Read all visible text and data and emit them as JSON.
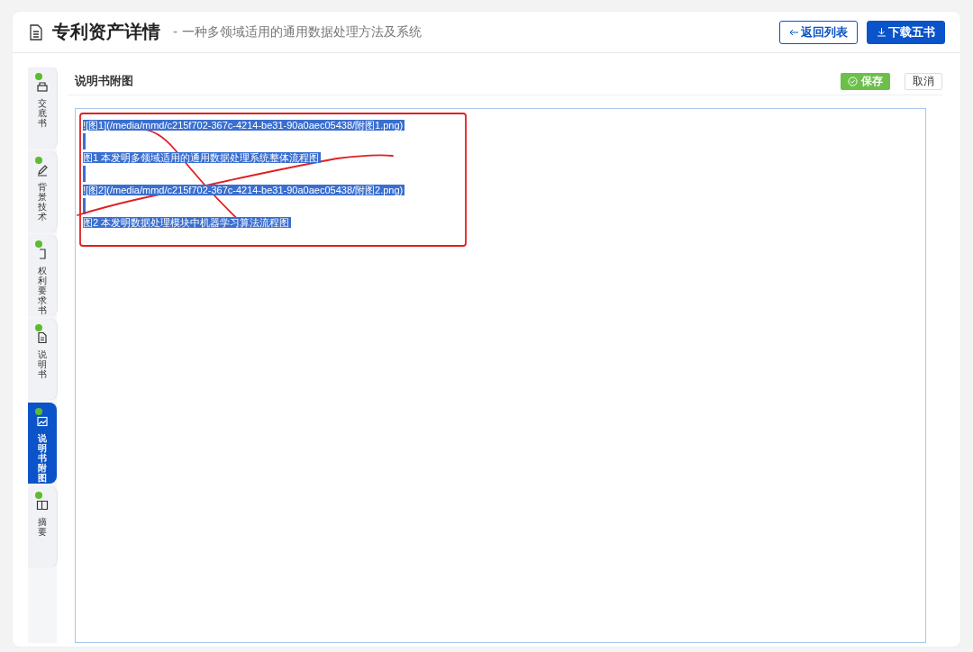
{
  "header": {
    "title": "专利资产详情",
    "subtitle": "- 一种多领域适用的通用数据处理方法及系统",
    "buttons": [
      {
        "label": "返回列表",
        "kind": "back"
      },
      {
        "label": "下载五书",
        "kind": "download"
      }
    ]
  },
  "tabs": [
    {
      "label": "交底书",
      "done": true,
      "selected": false
    },
    {
      "label": "背景技术",
      "done": true,
      "selected": false
    },
    {
      "label": "权利要求书",
      "done": true,
      "selected": false
    },
    {
      "label": "说明书",
      "done": true,
      "selected": false
    },
    {
      "label": "说明书附图",
      "done": true,
      "selected": true
    },
    {
      "label": "摘要",
      "done": true,
      "selected": false
    }
  ],
  "section": {
    "title": "说明书附图",
    "save": "保存",
    "cancel": "取消"
  },
  "editor": {
    "text_selected": true,
    "lines": [
      "![图1](/media/mmd/c215f702-367c-4214-be31-90a0aec05438/附图1.png)",
      "图1 本发明多领域适用的通用数据处理系统整体流程图",
      "![图2](/media/mmd/c215f702-367c-4214-be31-90a0aec05438/附图2.png)",
      "图2 本发明数据处理模块中机器学习算法流程图"
    ]
  }
}
